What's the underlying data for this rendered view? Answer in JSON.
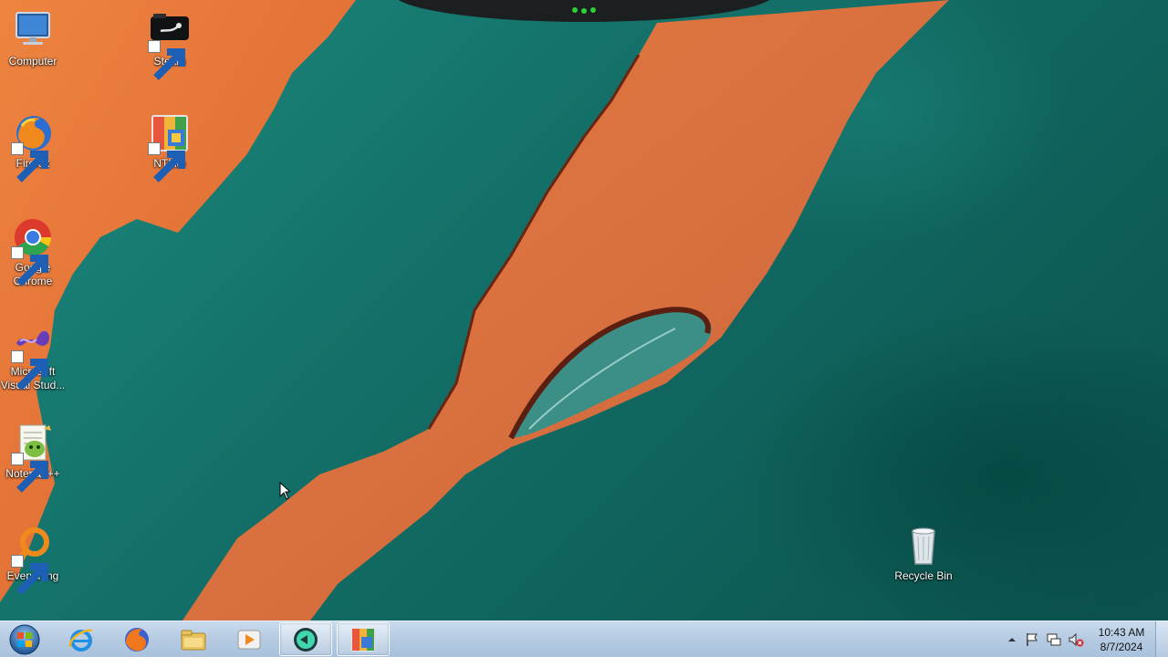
{
  "desktop": {
    "icons_left": [
      {
        "label": "Computer",
        "icon": "computer-icon"
      },
      {
        "label": "Firefox",
        "icon": "firefox-icon"
      },
      {
        "label": "Google Chrome",
        "icon": "chrome-icon"
      },
      {
        "label": "Microsoft Visual Stud...",
        "icon": "visual-studio-icon"
      },
      {
        "label": "Notepad++",
        "icon": "notepadpp-icon"
      },
      {
        "label": "Everything",
        "icon": "everything-icon"
      }
    ],
    "icons_second": [
      {
        "label": "Steam",
        "icon": "steam-icon"
      },
      {
        "label": "NTLite",
        "icon": "ntlite-icon"
      }
    ],
    "recycle_bin": {
      "label": "Recycle Bin",
      "icon": "recycle-bin-icon"
    }
  },
  "taskbar": {
    "start": {
      "icon": "windows-start-icon"
    },
    "pinned": [
      {
        "icon": "internet-explorer-icon"
      },
      {
        "icon": "firefox-icon"
      },
      {
        "icon": "file-explorer-icon"
      },
      {
        "icon": "media-player-icon"
      },
      {
        "icon": "app-icon",
        "active": true
      },
      {
        "icon": "ntlite-icon",
        "active": true
      }
    ],
    "tray": {
      "icons": [
        "show-hidden-icons-icon",
        "action-center-flag-icon",
        "network-icon",
        "volume-muted-icon"
      ],
      "time": "10:43 AM",
      "date": "8/7/2024"
    }
  },
  "colors": {
    "land": "#e0733a",
    "sea": "#137068",
    "taskbar": "#b7cce3"
  }
}
